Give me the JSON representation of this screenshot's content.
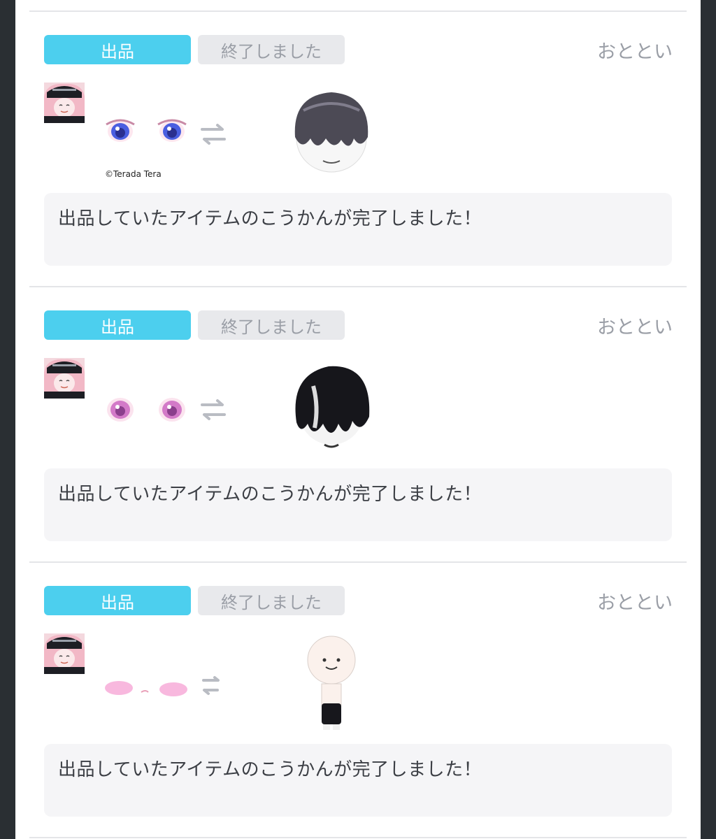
{
  "list": {
    "items": [
      {
        "tag_listing": "出品",
        "tag_status": "終了しました",
        "time": "おととい",
        "credit": "©Terada Tera",
        "message": "出品していたアイテムのこうかんが完了しました！",
        "left_item": "eyes-blue-item",
        "right_item": "hair-gray-item"
      },
      {
        "tag_listing": "出品",
        "tag_status": "終了しました",
        "time": "おととい",
        "credit": "",
        "message": "出品していたアイテムのこうかんが完了しました！",
        "left_item": "eyes-pink-item",
        "right_item": "hair-black-item"
      },
      {
        "tag_listing": "出品",
        "tag_status": "終了しました",
        "time": "おととい",
        "credit": "",
        "message": "出品していたアイテムのこうかんが完了しました！",
        "left_item": "blush-item",
        "right_item": "body-item"
      }
    ]
  },
  "colors": {
    "accent": "#4ccfee",
    "status_bg": "#e8e9ec",
    "text_muted": "#9a9ea6",
    "message_bg": "#f5f5f7"
  }
}
